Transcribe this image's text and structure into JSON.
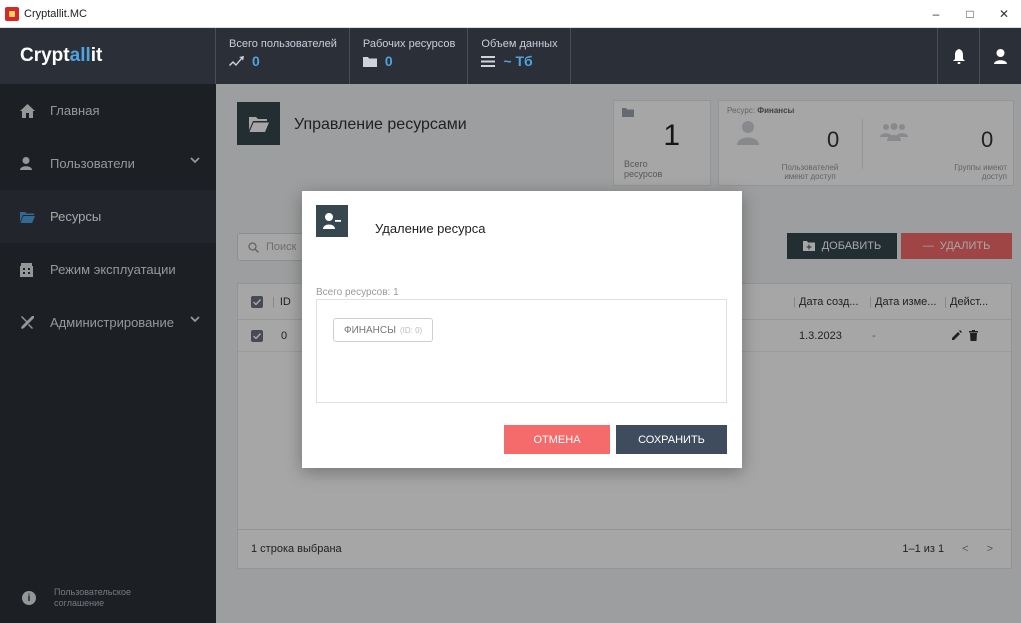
{
  "window": {
    "title": "Cryptallit.MC"
  },
  "header": {
    "logo_main": "Crypt",
    "logo_accent": "all",
    "logo_tail": "it",
    "stats": [
      {
        "label": "Всего пользователей",
        "value": "0",
        "icon": "activity-icon"
      },
      {
        "label": "Рабочих ресурсов",
        "value": "0",
        "icon": "folder-icon"
      },
      {
        "label": "Объем данных",
        "value": "~ Tб",
        "icon": "list-icon"
      }
    ]
  },
  "sidebar": {
    "items": [
      {
        "label": "Главная",
        "icon": "home-icon"
      },
      {
        "label": "Пользователи",
        "icon": "user-icon"
      },
      {
        "label": "Ресурсы",
        "icon": "folder-icon"
      },
      {
        "label": "Режим эксплуатации",
        "icon": "building-icon"
      },
      {
        "label": "Администрирование",
        "icon": "tools-icon"
      }
    ],
    "footer": "Пользовательское соглашение"
  },
  "page": {
    "title": "Управление ресурсами",
    "total_card": {
      "value": "1",
      "label": "Всего ресурсов"
    },
    "resource_card": {
      "prefix": "Ресурс: ",
      "name": "Финансы",
      "users_value": "0",
      "users_label": "Пользователей имеют доступ",
      "groups_value": "0",
      "groups_label": "Группы имеют доступ"
    },
    "search_placeholder": "Поиск",
    "add_label": "Добавить",
    "delete_label": "Удалить",
    "table": {
      "columns": [
        "ID",
        "Дата созд...",
        "Дата изме...",
        "Дейст..."
      ],
      "rows": [
        {
          "id": "0",
          "created": "1.3.2023",
          "modified": "-"
        }
      ]
    },
    "footer_selected": "1 строка выбрана",
    "pagination": "1–1 из 1"
  },
  "dialog": {
    "title": "Удаление ресурса",
    "subtitle": "Всего ресурсов: 1",
    "chip_name": "ФИНАНСЫ",
    "chip_id": "(ID: 0)",
    "cancel_label": "ОТМЕНА",
    "save_label": "СОХРАНИТЬ"
  }
}
